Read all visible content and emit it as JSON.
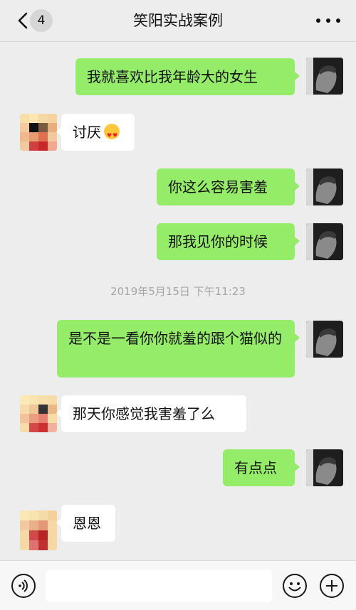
{
  "header": {
    "unread_count": "4",
    "title": "笑阳实战案例"
  },
  "messages": [
    {
      "side": "me",
      "text": "我就喜欢比我年龄大的女生"
    },
    {
      "side": "other",
      "text": "讨厌",
      "emoji": "heart-eyes-emoji"
    },
    {
      "side": "me",
      "text": "你这么容易害羞"
    },
    {
      "side": "me",
      "text": "那我见你的时候"
    },
    {
      "side": "me",
      "text": "是不是一看你你就羞的跟个猫似的"
    },
    {
      "side": "other",
      "text": "那天你感觉我害羞了么"
    },
    {
      "side": "me",
      "text": "有点点"
    },
    {
      "side": "other",
      "text": "恩恩"
    }
  ],
  "timestamp": "2019年5月15日 下午11:23",
  "input": {
    "value": "",
    "placeholder": ""
  },
  "colors": {
    "my_bubble": "#95ec69",
    "other_bubble": "#ffffff",
    "background": "#ededed"
  },
  "icons": [
    "back-icon",
    "more-icon",
    "voice-icon",
    "emoji-icon",
    "plus-icon"
  ]
}
